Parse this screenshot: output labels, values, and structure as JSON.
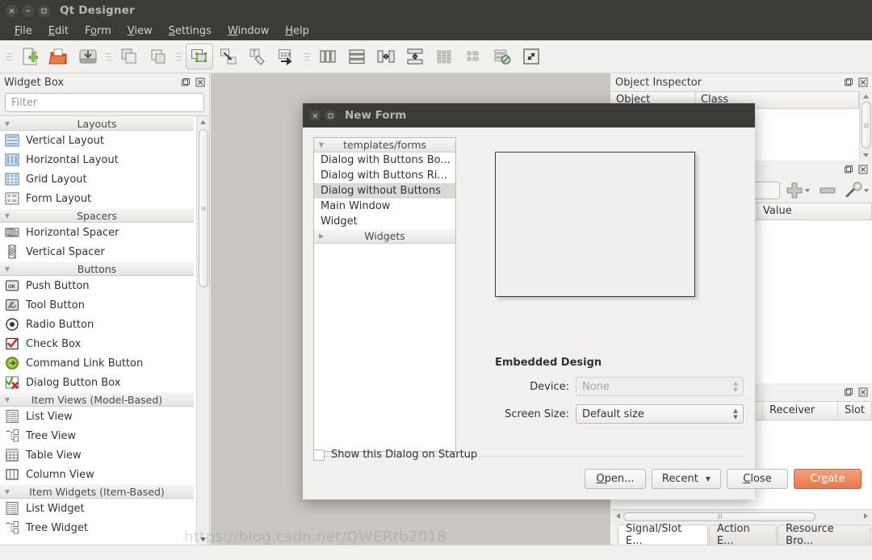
{
  "window": {
    "title": "Qt Designer",
    "buttons": [
      {
        "name": "close",
        "glyph": "×"
      },
      {
        "name": "minimize",
        "glyph": "−"
      },
      {
        "name": "maximize",
        "glyph": "□"
      }
    ]
  },
  "menubar": {
    "items": [
      {
        "label": "File",
        "mnemonic": "F"
      },
      {
        "label": "Edit",
        "mnemonic": "E"
      },
      {
        "label": "Form",
        "mnemonic": "o"
      },
      {
        "label": "View",
        "mnemonic": "V"
      },
      {
        "label": "Settings",
        "mnemonic": "S"
      },
      {
        "label": "Window",
        "mnemonic": "W"
      },
      {
        "label": "Help",
        "mnemonic": "H"
      }
    ]
  },
  "toolbar": {
    "groups": [
      {
        "buttons": [
          {
            "icon": "new-form-icon",
            "label": "New"
          },
          {
            "icon": "open-form-icon",
            "label": "Open"
          },
          {
            "icon": "save-form-icon",
            "label": "Save"
          }
        ]
      },
      {
        "buttons": [
          {
            "icon": "undo-icon",
            "label": "Undo"
          },
          {
            "icon": "redo-icon",
            "label": "Redo"
          }
        ]
      },
      {
        "buttons": [
          {
            "icon": "edit-widgets-icon",
            "label": "Edit Widgets",
            "active": true
          },
          {
            "icon": "edit-signals-slots-icon",
            "label": "Edit Signals/Slots"
          },
          {
            "icon": "edit-buddies-icon",
            "label": "Edit Buddies"
          },
          {
            "icon": "edit-tab-order-icon",
            "label": "Edit Tab Order"
          }
        ]
      },
      {
        "buttons": [
          {
            "icon": "layout-horizontal-icon",
            "label": "Lay Out Horizontally"
          },
          {
            "icon": "layout-vertical-icon",
            "label": "Lay Out Vertically"
          },
          {
            "icon": "layout-splitter-h-icon",
            "label": "Lay Out Horizontally in Splitter"
          },
          {
            "icon": "layout-splitter-v-icon",
            "label": "Lay Out Vertically in Splitter"
          },
          {
            "icon": "layout-grid-icon",
            "label": "Lay Out in a Grid"
          },
          {
            "icon": "layout-form-icon",
            "label": "Lay Out in a Form Layout"
          },
          {
            "icon": "break-layout-icon",
            "label": "Break Layout"
          },
          {
            "icon": "adjust-size-icon",
            "label": "Adjust Size"
          }
        ]
      }
    ]
  },
  "widget_box": {
    "title": "Widget Box",
    "filter_placeholder": "Filter",
    "filter_value": "",
    "float_icon": "undock-icon",
    "close_icon": "close-icon",
    "groups": [
      {
        "name": "Layouts",
        "expanded": true,
        "items": [
          {
            "label": "Vertical Layout",
            "icon": "vertical-layout-icon"
          },
          {
            "label": "Horizontal Layout",
            "icon": "horizontal-layout-icon"
          },
          {
            "label": "Grid Layout",
            "icon": "grid-layout-icon"
          },
          {
            "label": "Form Layout",
            "icon": "form-layout-icon"
          }
        ]
      },
      {
        "name": "Spacers",
        "expanded": true,
        "items": [
          {
            "label": "Horizontal Spacer",
            "icon": "horizontal-spacer-icon"
          },
          {
            "label": "Vertical Spacer",
            "icon": "vertical-spacer-icon"
          }
        ]
      },
      {
        "name": "Buttons",
        "expanded": true,
        "items": [
          {
            "label": "Push Button",
            "icon": "push-button-icon"
          },
          {
            "label": "Tool Button",
            "icon": "tool-button-icon"
          },
          {
            "label": "Radio Button",
            "icon": "radio-button-icon"
          },
          {
            "label": "Check Box",
            "icon": "check-box-icon"
          },
          {
            "label": "Command Link Button",
            "icon": "command-link-button-icon"
          },
          {
            "label": "Dialog Button Box",
            "icon": "dialog-button-box-icon"
          }
        ]
      },
      {
        "name": "Item Views (Model-Based)",
        "expanded": true,
        "items": [
          {
            "label": "List View",
            "icon": "list-view-icon"
          },
          {
            "label": "Tree View",
            "icon": "tree-view-icon"
          },
          {
            "label": "Table View",
            "icon": "table-view-icon"
          },
          {
            "label": "Column View",
            "icon": "column-view-icon"
          }
        ]
      },
      {
        "name": "Item Widgets (Item-Based)",
        "expanded": true,
        "items": [
          {
            "label": "List Widget",
            "icon": "list-widget-icon"
          },
          {
            "label": "Tree Widget",
            "icon": "tree-widget-icon"
          }
        ]
      }
    ]
  },
  "object_inspector": {
    "title": "Object Inspector",
    "columns": [
      "Object",
      "Class"
    ],
    "rows": []
  },
  "property_editor": {
    "columns": [
      "Value"
    ],
    "toolbar": [
      {
        "icon": "property-filter-input",
        "label": ""
      },
      {
        "icon": "add-icon",
        "label": "Add"
      },
      {
        "icon": "remove-icon",
        "label": "Remove"
      },
      {
        "icon": "configure-icon",
        "label": "Configure"
      }
    ]
  },
  "signal_slot_editor": {
    "columns": [
      "Receiver",
      "Slot"
    ],
    "tabs": [
      {
        "label": "Signal/Slot E...",
        "selected": true
      },
      {
        "label": "Action E...",
        "selected": false
      },
      {
        "label": "Resource Bro...",
        "selected": false
      }
    ]
  },
  "new_form_dialog": {
    "title": "New Form",
    "buttons": [
      {
        "name": "close",
        "glyph": "×"
      },
      {
        "name": "maximize",
        "glyph": "□"
      }
    ],
    "template_groups": [
      {
        "name": "templates/forms",
        "expanded": true,
        "items": [
          {
            "label": "Dialog with Buttons Bo...",
            "selected": false
          },
          {
            "label": "Dialog with Buttons Ri...",
            "selected": false
          },
          {
            "label": "Dialog without Buttons",
            "selected": true
          },
          {
            "label": "Main Window",
            "selected": false
          },
          {
            "label": "Widget",
            "selected": false
          }
        ]
      },
      {
        "name": "Widgets",
        "expanded": false,
        "items": []
      }
    ],
    "embedded_design": {
      "heading": "Embedded Design",
      "device_label": "Device:",
      "device_value": "None",
      "device_disabled": true,
      "screen_size_label": "Screen Size:",
      "screen_size_value": "Default size",
      "screen_size_disabled": false
    },
    "show_on_startup": {
      "label": "Show this Dialog on Startup",
      "checked": false
    },
    "actions": [
      {
        "label": "Open...",
        "mnemonic": "O",
        "name": "open-button",
        "primary": false,
        "caret": false
      },
      {
        "label": "Recent",
        "mnemonic": "",
        "name": "recent-button",
        "primary": false,
        "caret": true
      },
      {
        "label": "Close",
        "mnemonic": "C",
        "name": "close-button",
        "primary": false,
        "caret": false
      },
      {
        "label": "Create",
        "mnemonic": "e",
        "name": "create-button",
        "primary": true,
        "caret": false
      }
    ]
  },
  "watermark": "https://blog.csdn.net/QWERtb2018",
  "colors": {
    "titlebar": "#3c3b37",
    "chrome": "#f2f1f0",
    "workspace": "#c9c6c2",
    "accent": "#e8754a",
    "selection": "#dcd9d5",
    "text": "#2e3436"
  }
}
